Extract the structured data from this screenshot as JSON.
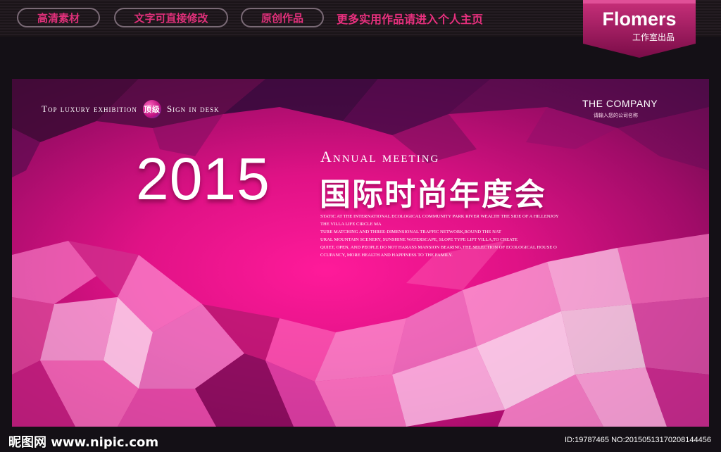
{
  "header": {
    "pills": [
      "高清素材",
      "文字可直接修改",
      "原创作品"
    ],
    "promo": "更多实用作品请进入个人主页",
    "brand_name": "Flomers",
    "brand_sub": "工作室出品"
  },
  "poster": {
    "tag_left_1": "Top luxury exhibition",
    "badge": "顶级",
    "tag_left_2": "Sign in desk",
    "company": "THE COMPANY",
    "company_sub": "请输入您的公司名称",
    "year": "2015",
    "annual": "Annual meeting",
    "cn_title": "国际时尚年度会",
    "desc_lines": [
      "STATIC AT THE INTERNATIONAL ECOLOGICAL COMMUNITY PARK RIVER WEALTH THE SIDE OF A HILLENJOY",
      "THE VILLA LIFE CIRCLE MA",
      "TURE MATCHING AND THREE-DIMENSIONAL TRAFFIC NETWORK,ROUND THE NAT",
      "URAL MOUNTAIN SCENERY, SUNSHINE WATERSCAPE, SLOPE TYPE LIFT VILLA,TO CREATE",
      "QUIET, OPEN, AND PEOPLE DO NOT HARASS MANSION BEARING,THE SELECTION OF ECOLOGICAL HOUSE O",
      "CCUPANCY, MORE HEALTH AND HAPPINESS TO THE FAMILY."
    ]
  },
  "footer": {
    "watermark": "昵图网 www.nipic.com",
    "image_id": "ID:19787465 NO:20150513170208144456"
  },
  "colors": {
    "accent_pink": "#e8307e",
    "poster_pink": "#ff1a9a",
    "brand_banner": "#b01a68"
  }
}
